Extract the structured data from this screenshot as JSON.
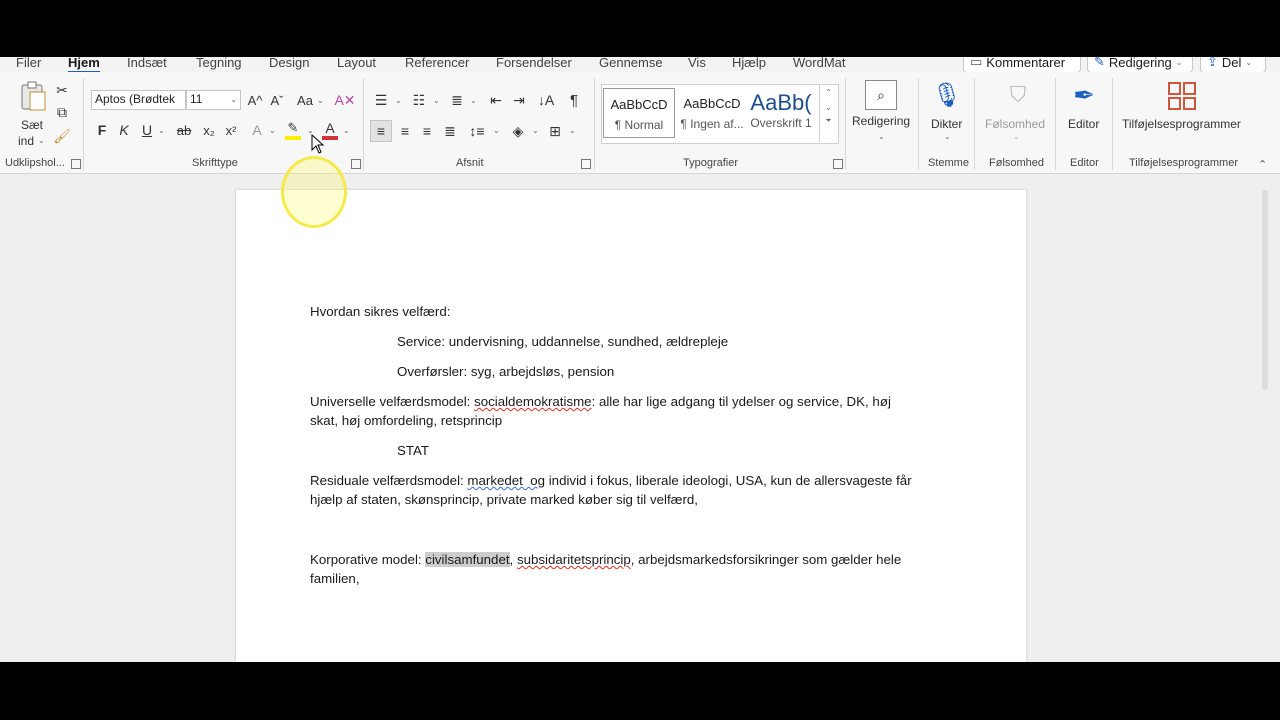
{
  "tabs": [
    "Filer",
    "Hjem",
    "Indsæt",
    "Tegning",
    "Design",
    "Layout",
    "Referencer",
    "Forsendelser",
    "Gennemse",
    "Vis",
    "Hjælp",
    "WordMat"
  ],
  "active_tab": "Hjem",
  "top_buttons": {
    "comments": "Kommentarer",
    "editing": "Redigering",
    "share": "Del"
  },
  "clipboard": {
    "paste_line1": "Sæt",
    "paste_line2": "ind",
    "group": "Udklipshol..."
  },
  "font": {
    "name": "Aptos (Brødtek",
    "size": "11",
    "group": "Skrifttype",
    "bold": "F",
    "italic": "K",
    "underline": "U",
    "strike": "ab",
    "sub": "x₂",
    "sup": "x²",
    "grow": "A^",
    "shrink": "Aˇ",
    "case": "Aa"
  },
  "paragraph": {
    "group": "Afsnit",
    "pilcrow": "¶"
  },
  "styles": {
    "group": "Typografier",
    "items": [
      {
        "preview": "AaBbCcD",
        "name": "¶ Normal"
      },
      {
        "preview": "AaBbCcD",
        "name": "¶ Ingen af..."
      },
      {
        "preview": "AaBb(",
        "name": "Overskrift 1"
      }
    ]
  },
  "editing": {
    "label": "Redigering"
  },
  "voice": {
    "label": "Dikter",
    "group": "Stemme"
  },
  "sensitivity": {
    "label": "Følsomhed",
    "group": "Følsomhed"
  },
  "editor": {
    "label": "Editor",
    "group": "Editor"
  },
  "addins": {
    "label": "Tilføjelsesprogrammer",
    "group": "Tilføjelsesprogrammer"
  },
  "document": {
    "p1": "Hvordan sikres velfærd:",
    "p2": "Service: undervisning, uddannelse, sundhed, ældrepleje",
    "p3": "Overførsler: syg, arbejdsløs, pension",
    "p4a": "Universelle velfærdsmodel: ",
    "p4b": "socialdemokratisme",
    "p4c": ": alle har lige adgang til ydelser og service, DK, høj",
    "p4d": "skat, høj omfordeling, retsprincip",
    "p5": "STAT",
    "p6a": "Residuale velfærdsmodel: ",
    "p6b": "markedet  og",
    "p6c": " individ i fokus, liberale ideologi, USA, kun de allersvageste får",
    "p6d": "hjælp af staten, skønsprincip, private marked køber sig til velfærd,",
    "p7a": "Korporative model: ",
    "p7b": "civilsamfundet",
    "p7c": ", ",
    "p7d": "subsidaritetsprincip",
    "p7e": ", arbejdsmarkedsforsikringer som gælder hele",
    "p7f": "familien,"
  },
  "colors": {
    "accent": "#1b5ebd",
    "highlight": "#ffee00",
    "font_color": "#d13438",
    "spell": "#d93025",
    "grammar": "#3a6fd8"
  }
}
